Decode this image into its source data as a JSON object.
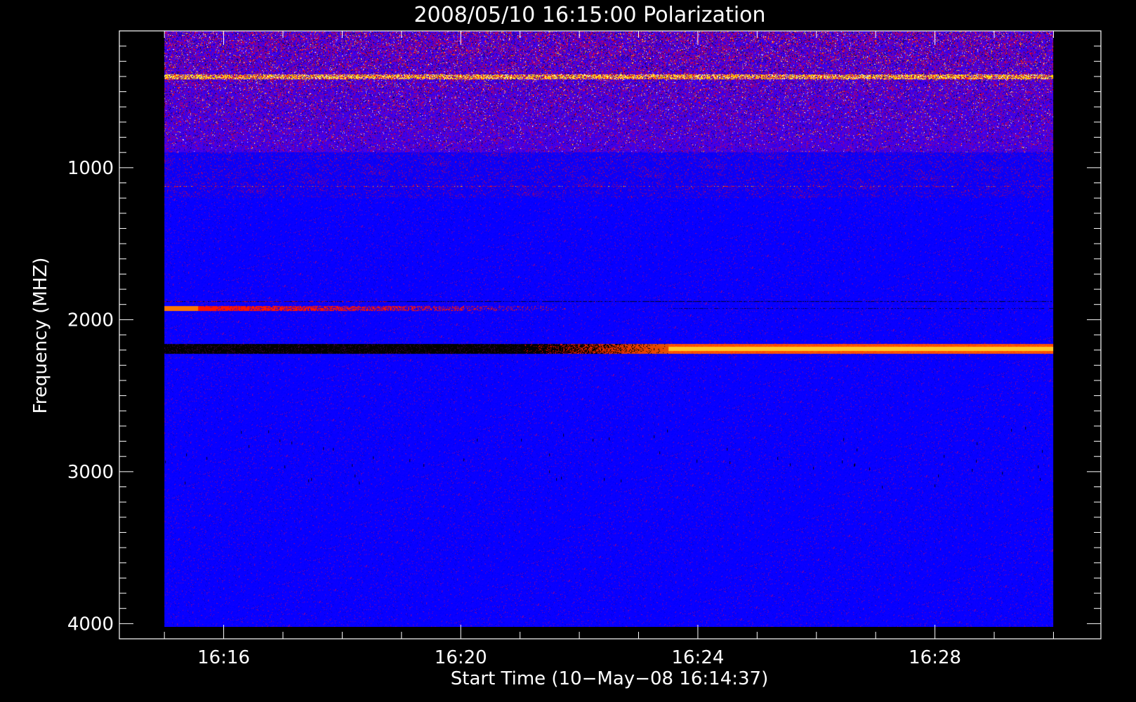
{
  "chart_data": {
    "type": "heatmap",
    "title": "2008/05/10 16:15:00 Polarization",
    "xlabel": "Start Time (10−May−08 16:14:37)",
    "ylabel": "Frequency (MHZ)",
    "x_ticks": [
      "16:16",
      "16:20",
      "16:24",
      "16:28"
    ],
    "x_tick_minutes": [
      16,
      20,
      24,
      28
    ],
    "x_range_minutes": [
      14.24,
      30.8
    ],
    "data_time_range_minutes": [
      15.0,
      30.0
    ],
    "y_ticks": [
      1000,
      2000,
      3000,
      4000
    ],
    "y_range": [
      100,
      4100
    ],
    "data_frequency_range": [
      100,
      4020
    ],
    "y_inverted": true,
    "grid": false,
    "background_color": "#0000ff",
    "frame_color": "#ffffff",
    "features": [
      {
        "kind": "noisy-band",
        "freq_range": [
          100,
          900
        ],
        "colors": [
          "#ff0000",
          "#ffd000",
          "#ffffff",
          "#000000"
        ]
      },
      {
        "kind": "bright-line",
        "freq": 400,
        "colors": [
          "#ffff00",
          "#ffffff"
        ]
      },
      {
        "kind": "dotted-line",
        "freq": 1120,
        "colors": [
          "#ff0000",
          "#ffd000"
        ]
      },
      {
        "kind": "red-band",
        "freq": 1920,
        "time_range_minutes": [
          15.0,
          22.0
        ],
        "color": "#ff2000"
      },
      {
        "kind": "dark-line",
        "freq": 1880,
        "color": "#000000"
      },
      {
        "kind": "transition-band",
        "freq_range": [
          2160,
          2220
        ],
        "start_color": "#000000",
        "end_color": "#ffcc00",
        "transition_minutes": [
          21.0,
          23.5
        ]
      }
    ]
  }
}
